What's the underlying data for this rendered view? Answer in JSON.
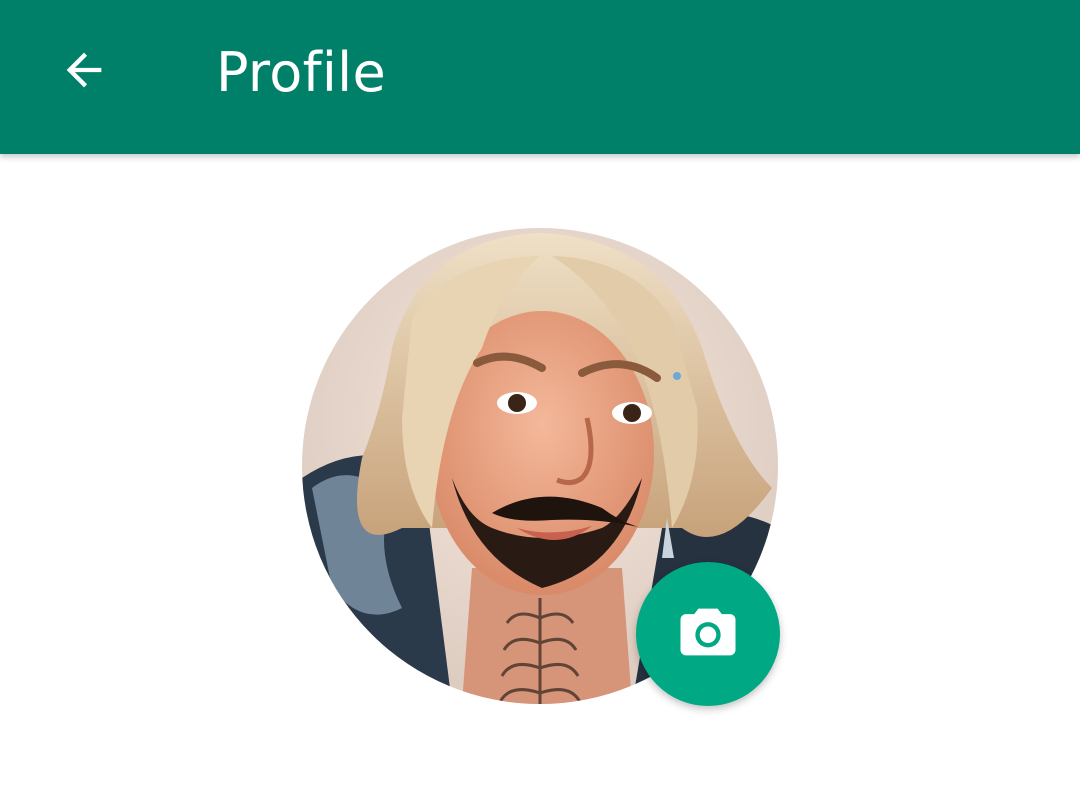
{
  "header": {
    "title": "Profile",
    "back_icon": "arrow-left-icon"
  },
  "profile": {
    "photo_description_icon": "profile-photo",
    "edit_photo_icon": "camera-icon"
  },
  "colors": {
    "app_bar": "#008069",
    "accent": "#00a884",
    "on_primary": "#ffffff",
    "background": "#ffffff"
  }
}
